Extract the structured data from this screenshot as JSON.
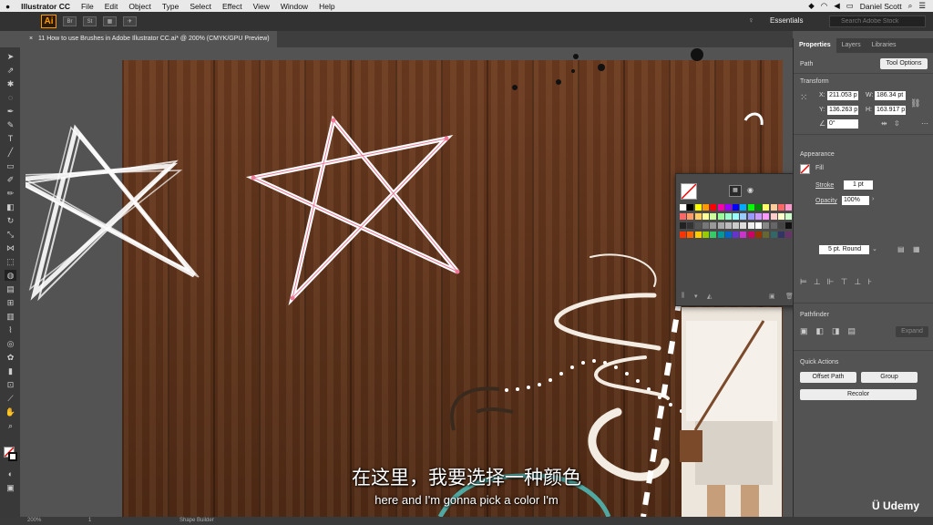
{
  "menubar": {
    "apple": "",
    "app_name": "Illustrator CC",
    "items": [
      "File",
      "Edit",
      "Object",
      "Type",
      "Select",
      "Effect",
      "View",
      "Window",
      "Help"
    ],
    "user": "Daniel Scott"
  },
  "appbar": {
    "logo": "Ai",
    "br": "Br",
    "st": "St",
    "workspace": "Essentials",
    "search_placeholder": "Search Adobe Stock"
  },
  "document": {
    "tab_title": "11 How to use Brushes in Adobe Illustrator CC.ai* @ 200% (CMYK/GPU Preview)"
  },
  "panel": {
    "tabs": [
      "Properties",
      "Layers",
      "Libraries"
    ],
    "selection_type": "Path",
    "tool_options": "Tool Options",
    "transform_title": "Transform",
    "x_label": "X:",
    "x_value": "211.053 p",
    "y_label": "Y:",
    "y_value": "136.263 p",
    "w_label": "W:",
    "w_value": "186.34 pt",
    "h_label": "H:",
    "h_value": "163.917 p",
    "angle_value": "0°",
    "appearance_title": "Appearance",
    "fill_label": "Fill",
    "stroke_label": "Stroke",
    "stroke_value": "1 pt",
    "opacity_label": "Opacity",
    "opacity_value": "100%",
    "brush_value": "5 pt. Round",
    "pathfinder_title": "Pathfinder",
    "expand": "Expand",
    "quick_actions_title": "Quick Actions",
    "offset_path": "Offset Path",
    "group": "Group",
    "recolor": "Recolor"
  },
  "statusbar": {
    "zoom": "200%",
    "page": "1",
    "tool": "Shape Builder"
  },
  "subtitles": {
    "chinese": "在这里，我要选择一种颜色",
    "english": "here and I'm gonna pick a color I'm"
  },
  "watermark": "Udemy",
  "colors": {
    "accent_orange": "#ff9a00",
    "wood": "#5d321a",
    "panel_bg": "#535353"
  }
}
